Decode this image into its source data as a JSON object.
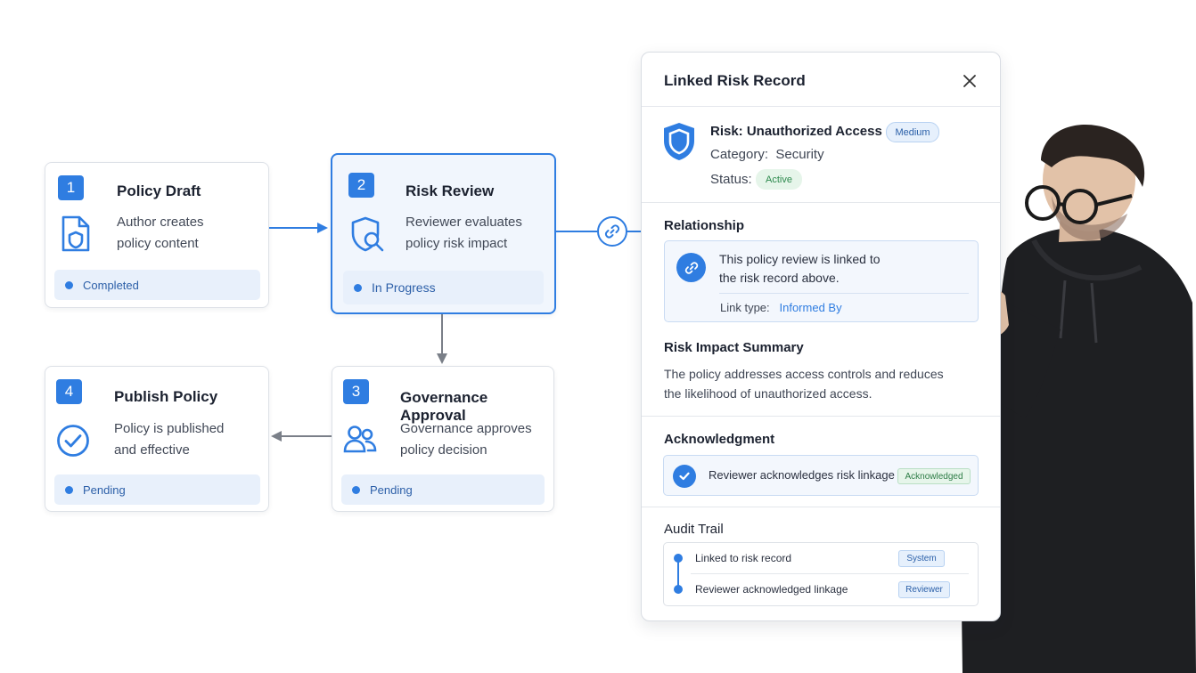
{
  "steps": [
    {
      "num": "1",
      "title": "Policy Draft",
      "desc1": "Author creates",
      "desc2": "policy content",
      "status": "Completed",
      "icon": "document-shield-icon"
    },
    {
      "num": "2",
      "title": "Risk Review",
      "desc1": "Reviewer evaluates",
      "desc2": "policy risk impact",
      "status": "In Progress",
      "icon": "shield-search-icon"
    },
    {
      "num": "3",
      "title": "Governance Approval",
      "desc1": "Governance approves",
      "desc2": "policy decision",
      "status": "Pending",
      "icon": "users-icon"
    },
    {
      "num": "4",
      "title": "Publish Policy",
      "desc1": "Policy is published",
      "desc2": "and effective",
      "status": "Pending",
      "icon": "check-circle-icon"
    }
  ],
  "panel": {
    "title": "Linked Risk Record",
    "risk": {
      "name": "Risk: Unauthorized Access",
      "severity": "Medium",
      "category_label": "Category:",
      "category_value": "Security",
      "status_label": "Status:",
      "status_value": "Active"
    },
    "relationship": {
      "title": "Relationship",
      "line1": "This policy review is linked to",
      "line2": "the risk record above.",
      "link_type_label": "Link type:",
      "link_type_value": "Informed By"
    },
    "impact": {
      "title": "Risk Impact Summary",
      "line1": "The policy addresses access controls and reduces",
      "line2": "the likelihood of unauthorized access."
    },
    "acknowledgment": {
      "title": "Acknowledgment",
      "text": "Reviewer acknowledges risk linkage",
      "badge": "Acknowledged"
    },
    "audit": {
      "title": "Audit Trail",
      "items": [
        {
          "text": "Linked to risk record",
          "badge": "System"
        },
        {
          "text": "Reviewer acknowledged linkage",
          "badge": "Reviewer"
        }
      ]
    }
  },
  "colors": {
    "accent": "#2f7de1",
    "active_green": "#2e9a55",
    "gray_arrow": "#7a7f88"
  }
}
